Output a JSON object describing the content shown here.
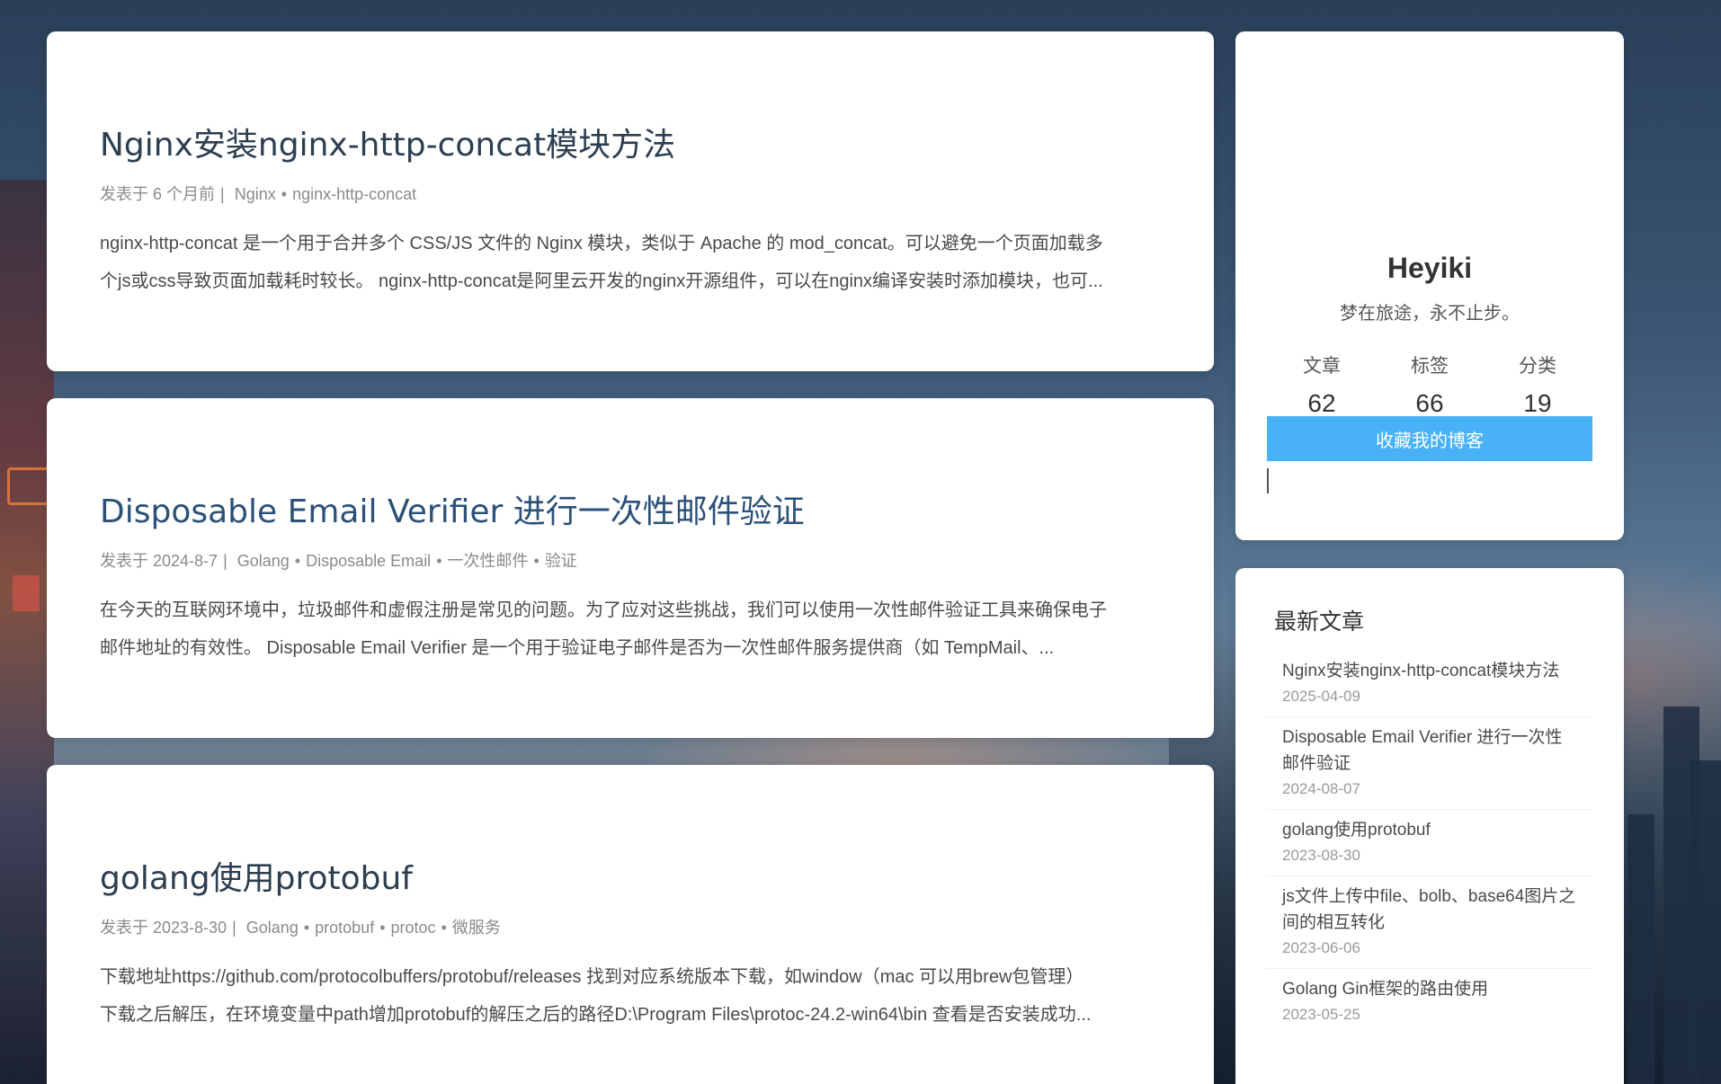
{
  "posts": [
    {
      "title": "Nginx安装nginx-http-concat模块方法",
      "meta_prefix": "发表于 6 个月前",
      "tags": [
        "Nginx",
        "nginx-http-concat"
      ],
      "excerpt_line1": "nginx-http-concat 是一个用于合并多个 CSS/JS 文件的 Nginx 模块，类似于 Apache 的 mod_concat。可以避免一个页面加载多",
      "excerpt_line2": "个js或css导致页面加载耗时较长。 nginx-http-concat是阿里云开发的nginx开源组件，可以在nginx编译安装时添加模块，也可..."
    },
    {
      "title": "Disposable Email Verifier 进行一次性邮件验证",
      "meta_prefix": "发表于 2024-8-7",
      "tags": [
        "Golang",
        "Disposable Email",
        "一次性邮件",
        "验证"
      ],
      "excerpt_line1": "在今天的互联网环境中，垃圾邮件和虚假注册是常见的问题。为了应对这些挑战，我们可以使用一次性邮件验证工具来确保电子",
      "excerpt_line2": "邮件地址的有效性。 Disposable Email Verifier 是一个用于验证电子邮件是否为一次性邮件服务提供商（如 TempMail、..."
    },
    {
      "title": "golang使用protobuf",
      "meta_prefix": "发表于 2023-8-30",
      "tags": [
        "Golang",
        "protobuf",
        "protoc",
        "微服务"
      ],
      "excerpt_line1": "下载地址https://github.com/protocolbuffers/protobuf/releases 找到对应系统版本下载，如window（mac 可以用brew包管理）",
      "excerpt_line2": "下载之后解压，在环境变量中path增加protobuf的解压之后的路径D:\\Program Files\\protoc-24.2-win64\\bin 查看是否安装成功..."
    }
  ],
  "meta_separator": "|",
  "tag_separator": "•",
  "profile": {
    "name": "Heyiki",
    "motto": "梦在旅途，永不止步。",
    "stats": [
      {
        "label": "文章",
        "value": "62"
      },
      {
        "label": "标签",
        "value": "66"
      },
      {
        "label": "分类",
        "value": "19"
      }
    ],
    "follow_label": "收藏我的博客"
  },
  "recent": {
    "header": "最新文章",
    "items": [
      {
        "title": "Nginx安装nginx-http-concat模块方法",
        "date": "2025-04-09"
      },
      {
        "title": "Disposable Email Verifier 进行一次性邮件验证",
        "date": "2024-08-07"
      },
      {
        "title": "golang使用protobuf",
        "date": "2023-08-30"
      },
      {
        "title": "js文件上传中file、bolb、base64图片之间的相互转化",
        "date": "2023-06-06"
      },
      {
        "title": "Golang Gin框架的路由使用",
        "date": "2023-05-25"
      }
    ]
  },
  "theme": {
    "accent": "#49b1f5",
    "title_color": "#2c3e50"
  }
}
